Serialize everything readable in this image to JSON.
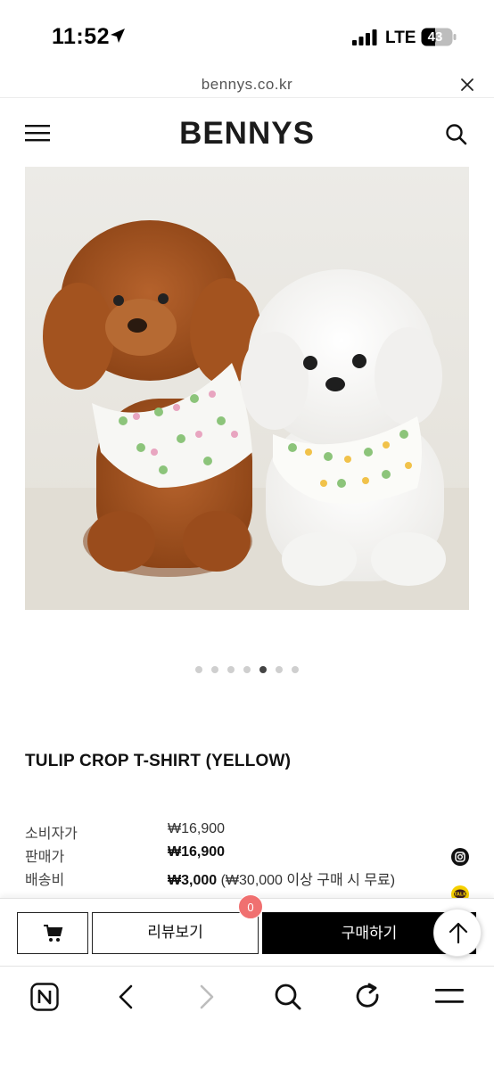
{
  "status_bar": {
    "time": "11:52",
    "network": "LTE",
    "battery": "43"
  },
  "url_bar": {
    "url": "bennys.co.kr"
  },
  "header": {
    "logo": "BENNYS"
  },
  "carousel": {
    "dot_count": 7,
    "active_index": 4
  },
  "product": {
    "title": "TULIP CROP T-SHIRT (YELLOW)",
    "prices": [
      {
        "label": "소비자가",
        "value": "₩16,900",
        "note": ""
      },
      {
        "label": "판매가",
        "value": "₩16,900",
        "note": ""
      },
      {
        "label": "배송비",
        "value": "₩3,000",
        "note": " (₩30,000 이상 구매 시 무료)"
      }
    ]
  },
  "actions": {
    "review_label": "리뷰보기",
    "review_count": "0",
    "buy_label": "구매하기"
  },
  "colors": {
    "accent_black": "#000000",
    "badge": "#f07070"
  },
  "icons": [
    "location-icon",
    "signal-icon",
    "battery-icon",
    "close-icon",
    "menu-icon",
    "search-icon",
    "instagram-icon",
    "kakao-talk-icon",
    "cart-icon",
    "arrow-up-icon",
    "naver-home-icon",
    "back-icon",
    "forward-icon",
    "refresh-icon"
  ]
}
